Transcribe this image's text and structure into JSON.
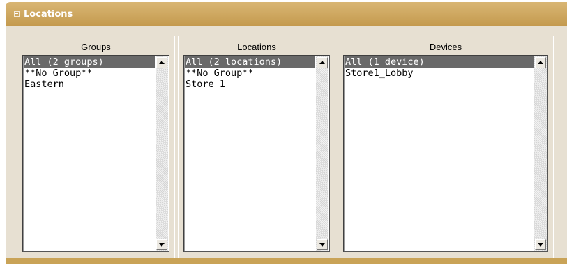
{
  "panel": {
    "title": "Locations"
  },
  "groups": {
    "header": "Groups",
    "items": [
      "All (2 groups)",
      "**No Group**",
      "Eastern"
    ],
    "selected_index": 0
  },
  "locations": {
    "header": "Locations",
    "items": [
      "All (2 locations)",
      "**No Group**",
      "Store 1"
    ],
    "selected_index": 0
  },
  "devices": {
    "header": "Devices",
    "items": [
      "All (1 device)",
      "Store1_Lobby"
    ],
    "selected_index": 0
  },
  "colors": {
    "header_bar": "#c49a4e",
    "panel_bg": "#e7e0d2",
    "selection": "#696969"
  },
  "icons": {
    "collapse": "collapse-icon",
    "scroll_up": "scroll-up-icon",
    "scroll_down": "scroll-down-icon"
  }
}
